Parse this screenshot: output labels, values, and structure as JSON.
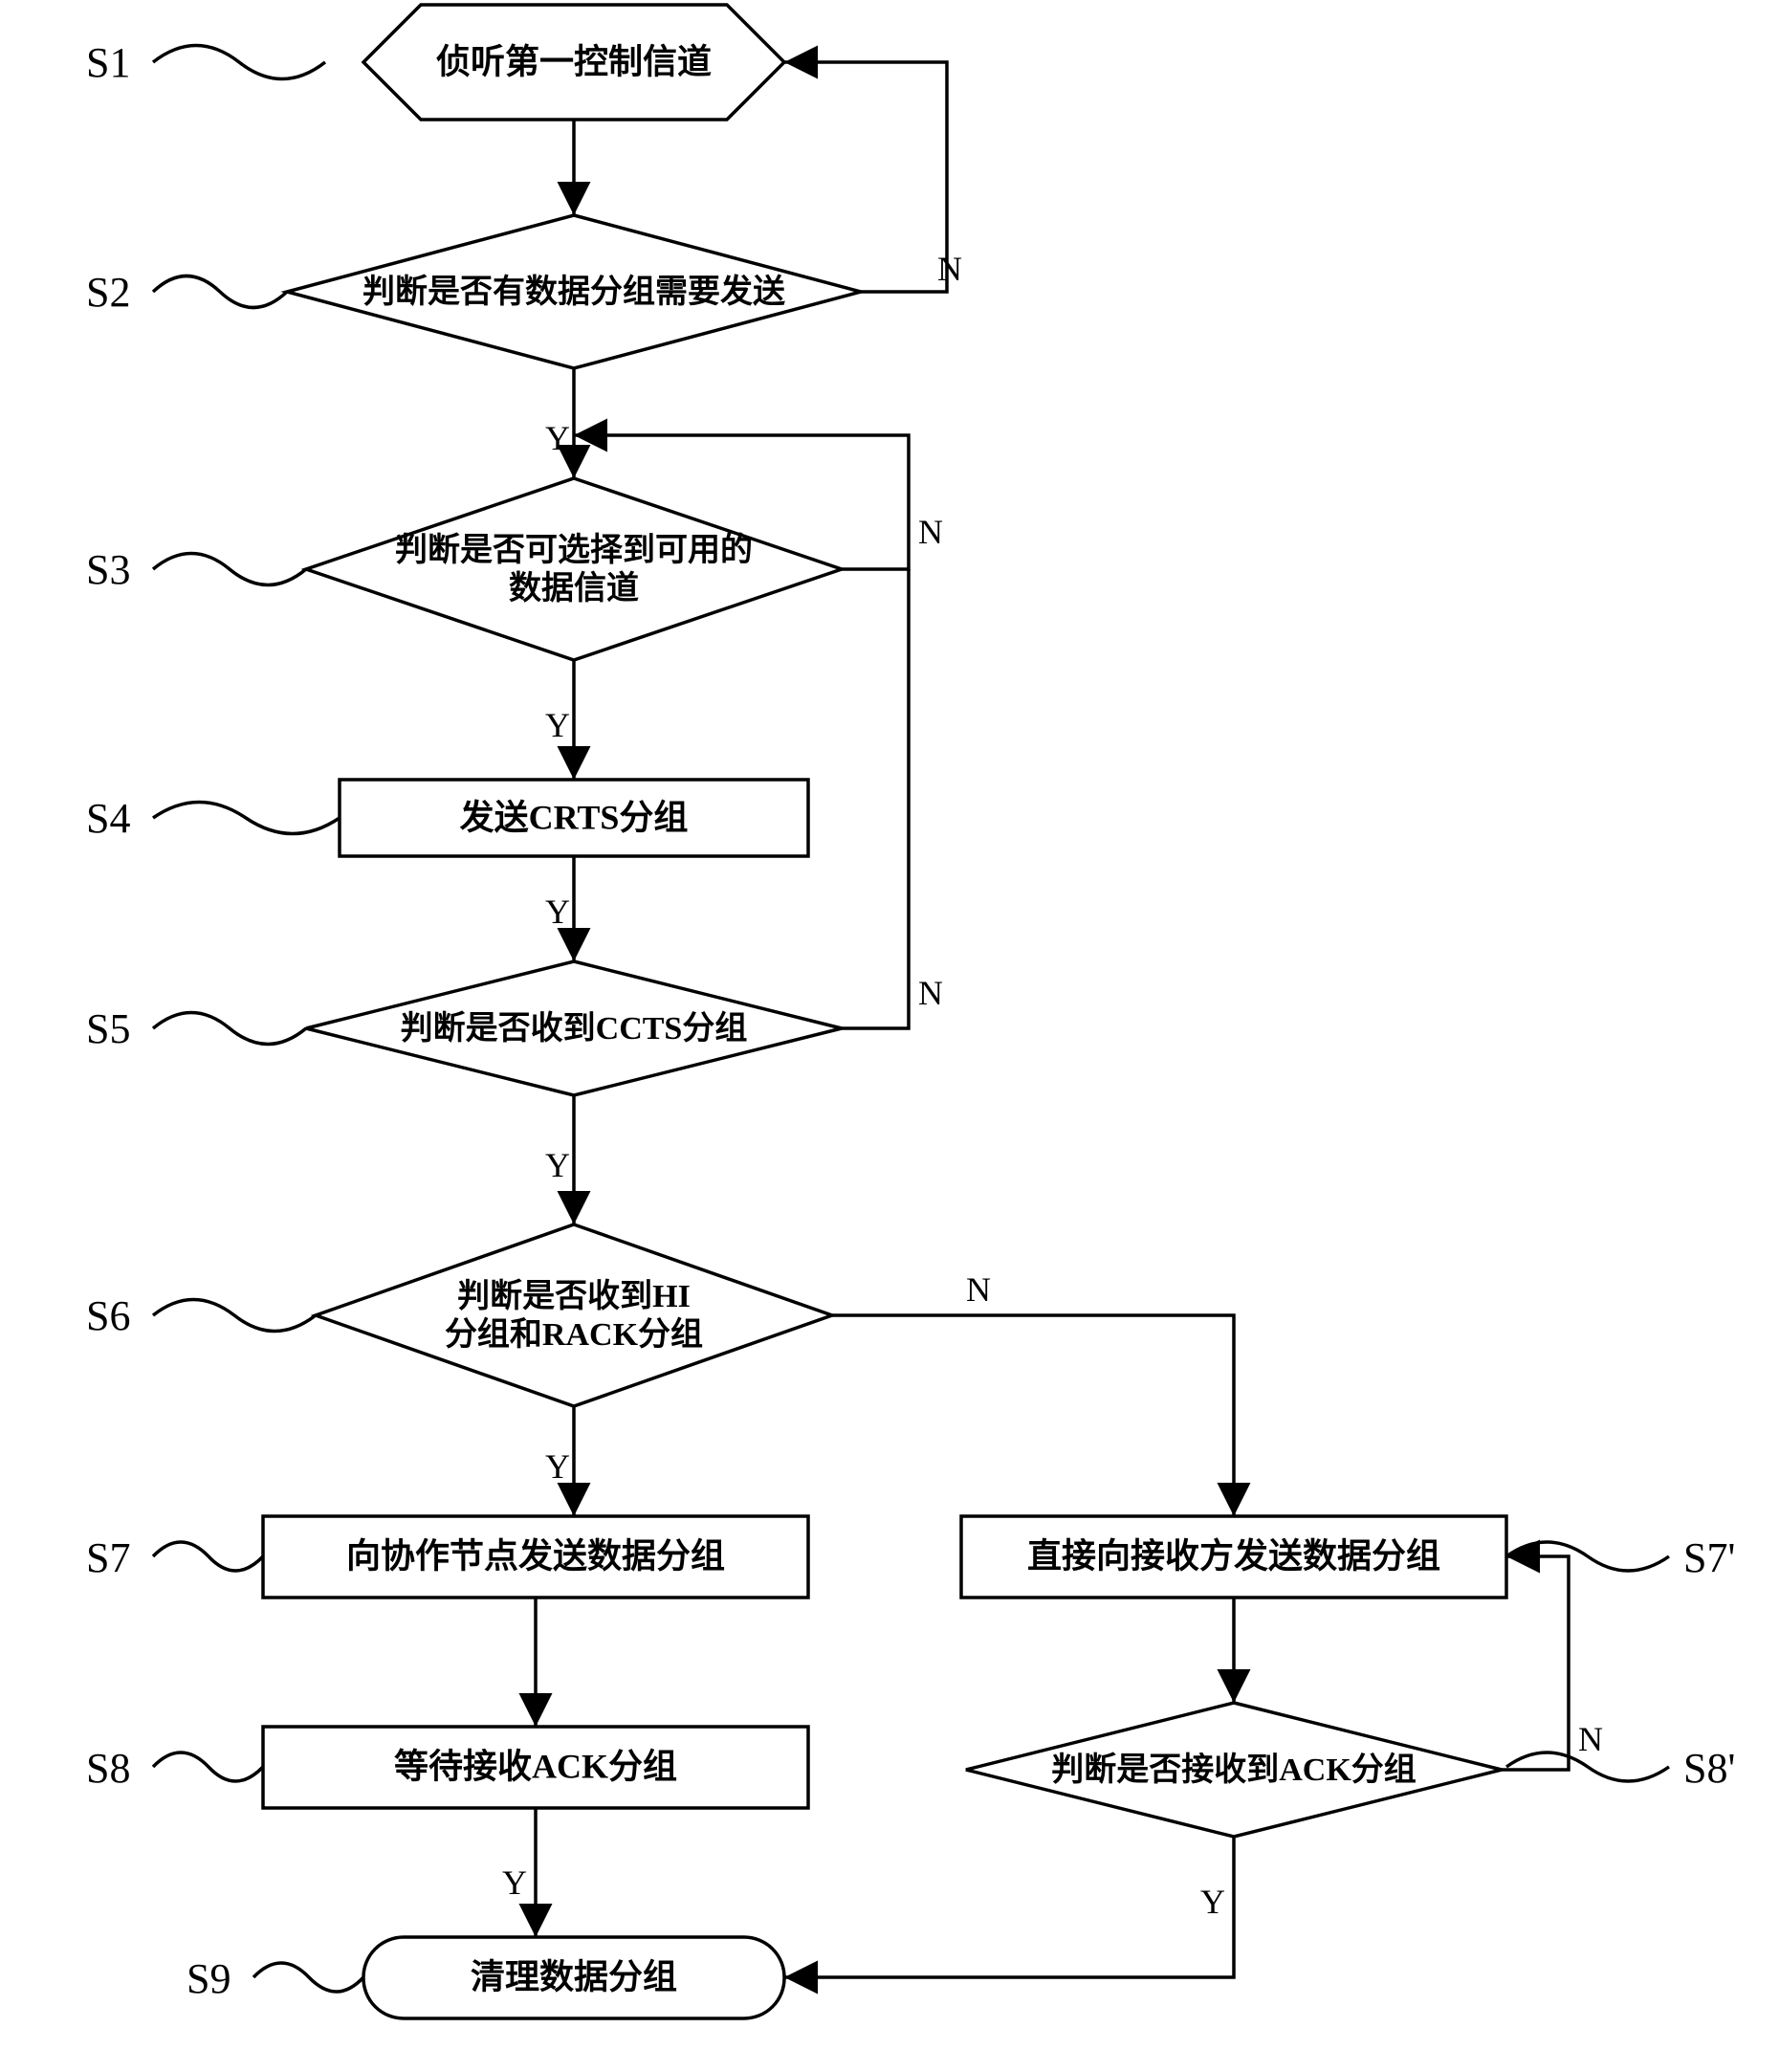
{
  "labels": {
    "s1": "S1",
    "s2": "S2",
    "s3": "S3",
    "s4": "S4",
    "s5": "S5",
    "s6": "S6",
    "s7": "S7",
    "s8": "S8",
    "s9": "S9",
    "s7p": "S7'",
    "s8p": "S8'"
  },
  "nodes": {
    "s1": "侦听第一控制信道",
    "s2": "判断是否有数据分组需要发送",
    "s3a": "判断是否可选择到可用的",
    "s3b": "数据信道",
    "s4": "发送CRTS分组",
    "s5": "判断是否收到CCTS分组",
    "s6a": "判断是否收到HI",
    "s6b": "分组和RACK分组",
    "s7": "向协作节点发送数据分组",
    "s8": "等待接收ACK分组",
    "s9": "清理数据分组",
    "s7p": "直接向接收方发送数据分组",
    "s8p": "判断是否接收到ACK分组"
  },
  "branches": {
    "yes": "Y",
    "no": "N"
  }
}
